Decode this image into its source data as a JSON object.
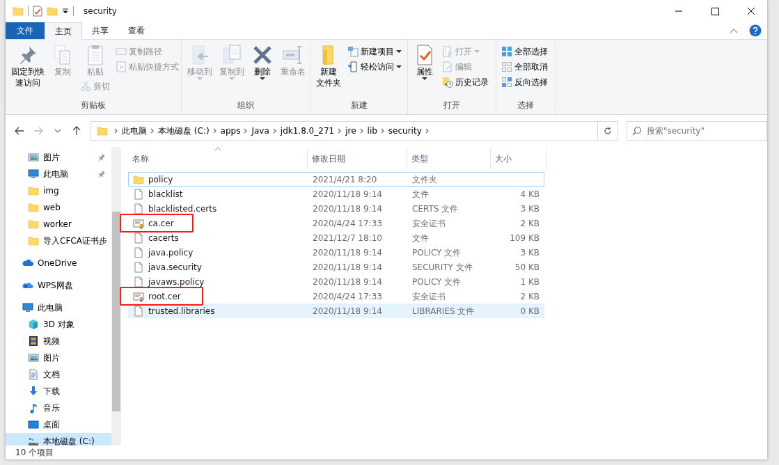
{
  "window": {
    "title": "security"
  },
  "ribbon": {
    "tabs": [
      {
        "label": "文件",
        "kind": "file-menu",
        "selected": false
      },
      {
        "label": "主页",
        "kind": "tab",
        "selected": true
      },
      {
        "label": "共享",
        "kind": "tab",
        "selected": false
      },
      {
        "label": "查看",
        "kind": "tab",
        "selected": false
      }
    ],
    "groups": [
      {
        "label": "剪贴板",
        "columns": [
          [
            {
              "lines": [
                "固定到快",
                "速访问"
              ],
              "kind": "large",
              "disabled": false,
              "dropdown": false
            }
          ],
          [
            {
              "label": "复制",
              "kind": "large",
              "disabled": true,
              "dropdown": false
            }
          ],
          [
            {
              "label": "粘贴",
              "kind": "large",
              "disabled": true,
              "dropdown": false
            },
            {
              "label": "剪切",
              "kind": "small",
              "disabled": true,
              "dropdown": false
            }
          ],
          [
            {
              "label": "复制路径",
              "kind": "small",
              "disabled": true,
              "dropdown": false
            },
            {
              "label": "粘贴快捷方式",
              "kind": "small",
              "disabled": true,
              "dropdown": false
            }
          ]
        ]
      },
      {
        "label": "组织",
        "columns": [
          [
            {
              "label": "移动到",
              "kind": "large",
              "disabled": true,
              "dropdown": true
            }
          ],
          [
            {
              "label": "复制到",
              "kind": "large",
              "disabled": true,
              "dropdown": true
            }
          ],
          [
            {
              "label": "删除",
              "kind": "large",
              "disabled": false,
              "dropdown": true
            }
          ],
          [
            {
              "label": "重命名",
              "kind": "large",
              "disabled": true,
              "dropdown": false
            }
          ]
        ]
      },
      {
        "label": "新建",
        "columns": [
          [
            {
              "lines": [
                "新建",
                "文件夹"
              ],
              "kind": "large",
              "disabled": false,
              "dropdown": false
            }
          ],
          [
            {
              "label": "新建项目",
              "kind": "small",
              "disabled": false,
              "dropdown": true
            },
            {
              "label": "轻松访问",
              "kind": "small",
              "disabled": false,
              "dropdown": true
            }
          ]
        ]
      },
      {
        "label": "打开",
        "columns": [
          [
            {
              "label": "属性",
              "kind": "large",
              "disabled": false,
              "dropdown": true
            }
          ],
          [
            {
              "label": "打开",
              "kind": "small",
              "disabled": true,
              "dropdown": true
            },
            {
              "label": "编辑",
              "kind": "small",
              "disabled": true,
              "dropdown": false
            },
            {
              "label": "历史记录",
              "kind": "small",
              "disabled": false,
              "dropdown": false
            }
          ]
        ]
      },
      {
        "label": "选择",
        "columns": [
          [
            {
              "label": "全部选择",
              "kind": "small",
              "disabled": false,
              "dropdown": false
            },
            {
              "label": "全部取消",
              "kind": "small",
              "disabled": false,
              "dropdown": false
            },
            {
              "label": "反向选择",
              "kind": "small",
              "disabled": false,
              "dropdown": false
            }
          ]
        ]
      }
    ]
  },
  "address": {
    "path": [
      "此电脑",
      "本地磁盘 (C:)",
      "apps",
      "Java",
      "jdk1.8.0_271",
      "jre",
      "lib",
      "security"
    ]
  },
  "search": {
    "placeholder": "搜索\"security\""
  },
  "sidebar": {
    "quick_access": [
      {
        "label": "图片",
        "kind": "pictures",
        "pinned": true
      },
      {
        "label": "此电脑",
        "kind": "computer",
        "pinned": true
      },
      {
        "label": "img",
        "kind": "folder",
        "pinned": false
      },
      {
        "label": "web",
        "kind": "folder",
        "pinned": false
      },
      {
        "label": "worker",
        "kind": "folder",
        "pinned": false
      },
      {
        "label": "导入CFCA证书步",
        "kind": "folder",
        "pinned": false
      }
    ],
    "sections": [
      {
        "label": "OneDrive",
        "kind": "cloud"
      },
      {
        "label": "WPS网盘",
        "kind": "cloud2"
      },
      {
        "label": "此电脑",
        "kind": "computer",
        "children": [
          {
            "label": "3D 对象",
            "kind": "cube",
            "selected": false
          },
          {
            "label": "视频",
            "kind": "video",
            "selected": false
          },
          {
            "label": "图片",
            "kind": "pictures",
            "selected": false
          },
          {
            "label": "文档",
            "kind": "document",
            "selected": false
          },
          {
            "label": "下载",
            "kind": "download",
            "selected": false
          },
          {
            "label": "音乐",
            "kind": "music",
            "selected": false
          },
          {
            "label": "桌面",
            "kind": "desktop",
            "selected": false
          },
          {
            "label": "本地磁盘 (C:)",
            "kind": "drive",
            "selected": true
          }
        ]
      }
    ]
  },
  "table": {
    "columns": [
      "名称",
      "修改日期",
      "类型",
      "大小"
    ],
    "rows": [
      {
        "name": "policy",
        "kind": "folder",
        "date": "2021/4/21 8:20",
        "type": "文件夹",
        "focused": true,
        "hovered": false,
        "highlighted": false
      },
      {
        "name": "blacklist",
        "kind": "file",
        "date": "2020/11/18 9:14",
        "type": "文件",
        "size": "4 KB",
        "focused": false,
        "hovered": false,
        "highlighted": false
      },
      {
        "name": "blacklisted.certs",
        "kind": "file",
        "date": "2020/11/18 9:14",
        "type": "CERTS 文件",
        "size": "3 KB",
        "focused": false,
        "hovered": false,
        "highlighted": false
      },
      {
        "name": "ca.cer",
        "kind": "certificate",
        "date": "2020/4/24 17:33",
        "type": "安全证书",
        "size": "2 KB",
        "focused": false,
        "hovered": false,
        "highlighted": true
      },
      {
        "name": "cacerts",
        "kind": "file",
        "date": "2021/12/7 18:10",
        "type": "文件",
        "size": "109 KB",
        "focused": false,
        "hovered": false,
        "highlighted": false
      },
      {
        "name": "java.policy",
        "kind": "file",
        "date": "2020/11/18 9:14",
        "type": "POLICY 文件",
        "size": "3 KB",
        "focused": false,
        "hovered": false,
        "highlighted": false
      },
      {
        "name": "java.security",
        "kind": "file",
        "date": "2020/11/18 9:14",
        "type": "SECURITY 文件",
        "size": "50 KB",
        "focused": false,
        "hovered": false,
        "highlighted": false
      },
      {
        "name": "javaws.policy",
        "kind": "file",
        "date": "2020/11/18 9:14",
        "type": "POLICY 文件",
        "size": "1 KB",
        "focused": false,
        "hovered": false,
        "highlighted": false
      },
      {
        "name": "root.cer",
        "kind": "certificate",
        "date": "2020/4/24 17:33",
        "type": "安全证书",
        "size": "2 KB",
        "focused": false,
        "hovered": false,
        "highlighted": true
      },
      {
        "name": "trusted.libraries",
        "kind": "file",
        "date": "2020/11/18 9:14",
        "type": "LIBRARIES 文件",
        "size": "0 KB",
        "focused": false,
        "hovered": true,
        "highlighted": false
      }
    ]
  },
  "status_bar": {
    "count": "10 个项目"
  }
}
